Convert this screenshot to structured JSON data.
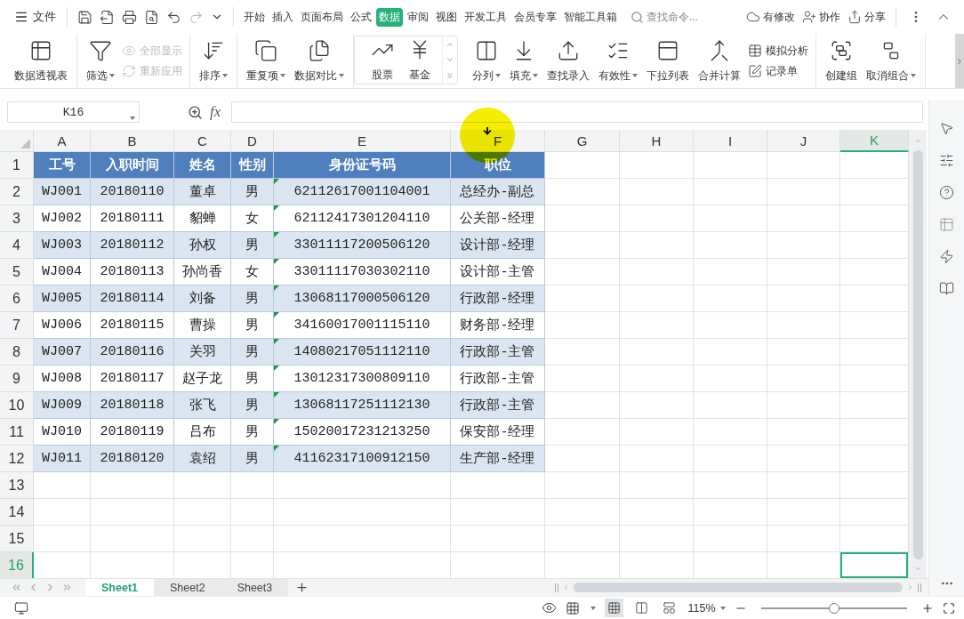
{
  "menu": {
    "file": "文件",
    "tabs": [
      {
        "label": "开始",
        "selected": false
      },
      {
        "label": "插入",
        "selected": false
      },
      {
        "label": "页面布局",
        "selected": false
      },
      {
        "label": "公式",
        "selected": false
      },
      {
        "label": "数据",
        "selected": true
      },
      {
        "label": "审阅",
        "selected": false
      },
      {
        "label": "视图",
        "selected": false
      },
      {
        "label": "开发工具",
        "selected": false
      },
      {
        "label": "会员专享",
        "selected": false
      },
      {
        "label": "智能工具箱",
        "selected": false
      }
    ],
    "search": {
      "placeholder": "查找命令..."
    },
    "actions": [
      "有修改",
      "协作",
      "分享"
    ]
  },
  "ribbon": [
    {
      "kind": "plain",
      "items": [
        {
          "kind": "large",
          "label": "数据透视表",
          "dropdown": false
        }
      ]
    },
    {
      "kind": "plain",
      "items": [
        {
          "kind": "large",
          "label": "筛选",
          "dropdown": true
        },
        {
          "kind": "stack",
          "items": [
            {
              "label": "全部显示",
              "disabled": true
            },
            {
              "label": "重新应用",
              "disabled": true
            }
          ]
        }
      ]
    },
    {
      "kind": "plain",
      "items": [
        {
          "kind": "large",
          "label": "排序",
          "dropdown": true
        }
      ]
    },
    {
      "kind": "plain",
      "items": [
        {
          "kind": "large",
          "label": "重复项",
          "dropdown": true
        },
        {
          "kind": "large",
          "label": "数据对比",
          "dropdown": true
        }
      ]
    },
    {
      "kind": "gallery",
      "items": [
        {
          "kind": "large",
          "label": "股票",
          "dropdown": false
        },
        {
          "kind": "large",
          "label": "基金",
          "dropdown": false
        }
      ]
    },
    {
      "kind": "plain",
      "items": [
        {
          "kind": "large",
          "label": "分列",
          "dropdown": true
        },
        {
          "kind": "large",
          "label": "填充",
          "dropdown": true
        },
        {
          "kind": "large",
          "label": "查找录入",
          "dropdown": false
        },
        {
          "kind": "large",
          "label": "有效性",
          "dropdown": true
        },
        {
          "kind": "large",
          "label": "下拉列表",
          "dropdown": false
        },
        {
          "kind": "large",
          "label": "合并计算",
          "dropdown": false
        },
        {
          "kind": "stack",
          "items": [
            {
              "label": "模拟分析",
              "disabled": false
            },
            {
              "label": "记录单",
              "disabled": false
            }
          ]
        }
      ]
    },
    {
      "kind": "plain",
      "items": [
        {
          "kind": "large",
          "label": "创建组",
          "dropdown": false
        },
        {
          "kind": "large",
          "label": "取消组合",
          "dropdown": true
        }
      ]
    }
  ],
  "formula_bar": {
    "name_box": "K16",
    "fx": "fx"
  },
  "columns": [
    {
      "letter": "A",
      "selected": false
    },
    {
      "letter": "B",
      "selected": false
    },
    {
      "letter": "C",
      "selected": false
    },
    {
      "letter": "D",
      "selected": false
    },
    {
      "letter": "E",
      "selected": false
    },
    {
      "letter": "F",
      "selected": false
    },
    {
      "letter": "G",
      "selected": false
    },
    {
      "letter": "H",
      "selected": false
    },
    {
      "letter": "I",
      "selected": false
    },
    {
      "letter": "J",
      "selected": false
    },
    {
      "letter": "K",
      "selected": true
    }
  ],
  "rows": [
    {
      "number": "1",
      "selected": false,
      "kind": "header",
      "cells": [
        "工号",
        "入职时间",
        "姓名",
        "性别",
        "身份证号码",
        "职位"
      ]
    },
    {
      "number": "2",
      "selected": false,
      "kind": "data",
      "shaded": true,
      "id_marker": true,
      "cells": [
        "WJ001",
        "20180110",
        "董卓",
        "男",
        "62112617001104001",
        "总经办-副总"
      ]
    },
    {
      "number": "3",
      "selected": false,
      "kind": "data",
      "shaded": false,
      "id_marker": true,
      "cells": [
        "WJ002",
        "20180111",
        "貂蝉",
        "女",
        "62112417301204110",
        "公关部-经理"
      ]
    },
    {
      "number": "4",
      "selected": false,
      "kind": "data",
      "shaded": true,
      "id_marker": true,
      "cells": [
        "WJ003",
        "20180112",
        "孙权",
        "男",
        "33011117200506120",
        "设计部-经理"
      ]
    },
    {
      "number": "5",
      "selected": false,
      "kind": "data",
      "shaded": false,
      "id_marker": true,
      "cells": [
        "WJ004",
        "20180113",
        "孙尚香",
        "女",
        "33011117030302110",
        "设计部-主管"
      ]
    },
    {
      "number": "6",
      "selected": false,
      "kind": "data",
      "shaded": true,
      "id_marker": true,
      "cells": [
        "WJ005",
        "20180114",
        "刘备",
        "男",
        "13068117000506120",
        "行政部-经理"
      ]
    },
    {
      "number": "7",
      "selected": false,
      "kind": "data",
      "shaded": false,
      "id_marker": true,
      "cells": [
        "WJ006",
        "20180115",
        "曹操",
        "男",
        "34160017001115110",
        "财务部-经理"
      ]
    },
    {
      "number": "8",
      "selected": false,
      "kind": "data",
      "shaded": true,
      "id_marker": true,
      "cells": [
        "WJ007",
        "20180116",
        "关羽",
        "男",
        "14080217051112110",
        "行政部-主管"
      ]
    },
    {
      "number": "9",
      "selected": false,
      "kind": "data",
      "shaded": false,
      "id_marker": true,
      "cells": [
        "WJ008",
        "20180117",
        "赵子龙",
        "男",
        "13012317300809110",
        "行政部-主管"
      ]
    },
    {
      "number": "10",
      "selected": false,
      "kind": "data",
      "shaded": true,
      "id_marker": true,
      "cells": [
        "WJ009",
        "20180118",
        "张飞",
        "男",
        "13068117251112130",
        "行政部-主管"
      ]
    },
    {
      "number": "11",
      "selected": false,
      "kind": "data",
      "shaded": false,
      "id_marker": true,
      "cells": [
        "WJ010",
        "20180119",
        "吕布",
        "男",
        "15020017231213250",
        "保安部-经理"
      ]
    },
    {
      "number": "12",
      "selected": false,
      "kind": "data",
      "shaded": true,
      "id_marker": true,
      "cells": [
        "WJ011",
        "20180120",
        "袁绍",
        "男",
        "41162317100912150",
        "生产部-经理"
      ]
    },
    {
      "number": "13",
      "selected": false,
      "kind": "empty"
    },
    {
      "number": "14",
      "selected": false,
      "kind": "empty"
    },
    {
      "number": "15",
      "selected": false,
      "kind": "empty"
    },
    {
      "number": "16",
      "selected": true,
      "kind": "empty"
    }
  ],
  "sheets": [
    {
      "label": "Sheet1",
      "selected": true
    },
    {
      "label": "Sheet2",
      "selected": false
    },
    {
      "label": "Sheet3",
      "selected": false
    }
  ],
  "status_bar": {
    "zoom": "115%",
    "zoom_slider": {
      "level": 0.5
    }
  }
}
